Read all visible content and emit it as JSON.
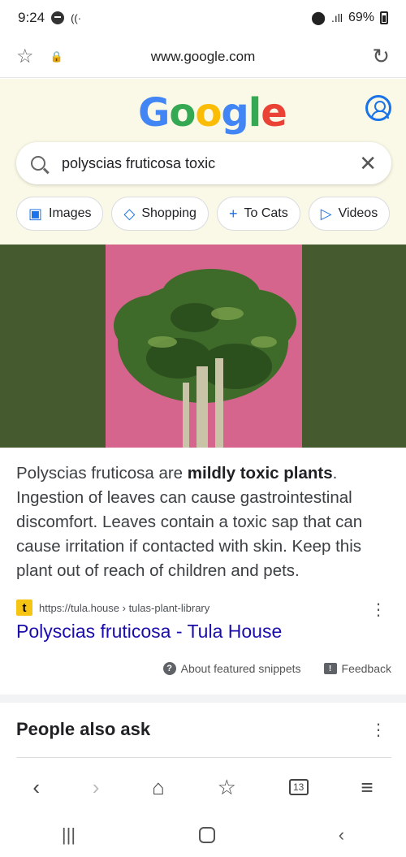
{
  "status": {
    "time": "9:24",
    "battery": "69%"
  },
  "url_bar": {
    "url": "www.google.com"
  },
  "search": {
    "query": "polyscias fruticosa toxic"
  },
  "chips": [
    {
      "label": "Images",
      "icon": "image-icon"
    },
    {
      "label": "Shopping",
      "icon": "tag-icon"
    },
    {
      "label": "To Cats",
      "icon": "plus-icon"
    },
    {
      "label": "Videos",
      "icon": "play-icon"
    }
  ],
  "snippet": {
    "text_before": "Polyscias fruticosa are ",
    "bold": "mildly toxic plants",
    "text_after": ". Ingestion of leaves can cause gastrointestinal discomfort. Leaves contain a toxic sap that can cause irritation if contacted with skin. Keep this plant out of reach of children and pets."
  },
  "result": {
    "url": "https://tula.house › tulas-plant-library",
    "title": "Polyscias fruticosa - Tula House",
    "favicon_letter": "t"
  },
  "feedback": {
    "about": "About featured snippets",
    "feedback": "Feedback"
  },
  "paa": {
    "title": "People also ask"
  },
  "toolbar": {
    "tabs_count": "13"
  },
  "colors": {
    "link": "#1a0dab",
    "accent": "#1a73e8",
    "doodle_bg": "#faf8e6",
    "image_bg": "#455a2e",
    "photo_bg": "#d5658d"
  }
}
